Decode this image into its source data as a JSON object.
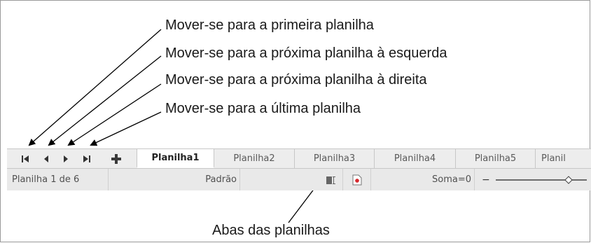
{
  "annotations": {
    "first_sheet": "Mover-se para a primeira planilha",
    "prev_sheet": "Mover-se para a próxima planilha à esquerda",
    "next_sheet": "Mover-se para a próxima planilha à direita",
    "last_sheet": "Mover-se para a última planilha",
    "sheet_tabs": "Abas das planilhas"
  },
  "tabbar": {
    "nav_icons": [
      "first-sheet-icon",
      "previous-sheet-icon",
      "next-sheet-icon",
      "last-sheet-icon",
      "add-sheet-icon"
    ],
    "tabs": [
      {
        "label": "Planilha1",
        "active": true
      },
      {
        "label": "Planilha2",
        "active": false
      },
      {
        "label": "Planilha3",
        "active": false
      },
      {
        "label": "Planilha4",
        "active": false
      },
      {
        "label": "Planilha5",
        "active": false
      },
      {
        "label": "Planil",
        "active": false
      }
    ]
  },
  "statusbar": {
    "sheet_position": "Planilha 1 de 6",
    "page_style": "Padrão",
    "sum": "Soma=0",
    "zoom_minus": "−"
  },
  "colors": {
    "tabbar_bg": "#ededed",
    "statusbar_bg": "#e9e9e9",
    "active_tab_bg": "#ffffff",
    "add_icon": "#3a3a3a",
    "document_modified_icon": "#d6262b"
  }
}
